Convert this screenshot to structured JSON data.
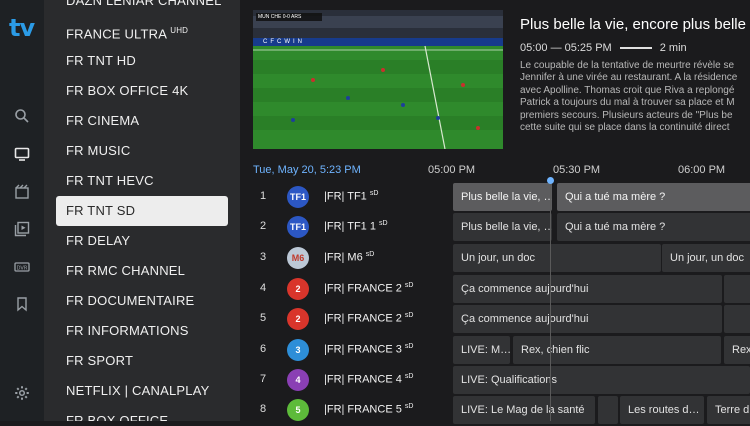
{
  "app": {
    "logo_text": "tv",
    "accent": "#2b9be6"
  },
  "rail": {
    "icons": [
      "search-icon",
      "tv-icon",
      "movie-icon",
      "series-icon",
      "dvr-icon",
      "bookmark-icon",
      "settings-icon"
    ]
  },
  "groups": [
    {
      "label": "DAZN LENIAR CHANNEL",
      "selected": false
    },
    {
      "label": "FRANCE ULTRA ",
      "sup": "UHD",
      "selected": false
    },
    {
      "label": "FR TNT HD",
      "selected": false
    },
    {
      "label": "FR BOX OFFICE 4K",
      "selected": false
    },
    {
      "label": "FR CINEMA",
      "selected": false
    },
    {
      "label": "FR  MUSIC",
      "selected": false
    },
    {
      "label": "FR TNT HEVC",
      "selected": false
    },
    {
      "label": "FR TNT SD",
      "selected": true
    },
    {
      "label": "FR DELAY",
      "selected": false
    },
    {
      "label": "FR RMC CHANNEL",
      "selected": false
    },
    {
      "label": "FR DOCUMENTAIRE",
      "selected": false
    },
    {
      "label": "FR INFORMATIONS",
      "selected": false
    },
    {
      "label": "FR SPORT",
      "selected": false
    },
    {
      "label": "NETFLIX | CANALPLAY",
      "selected": false
    },
    {
      "label": "FR BOX OFFICE",
      "selected": false
    }
  ],
  "preview": {
    "scorebug": "MUN  CHE  0-0  ARS",
    "ad_board": "CFCWIN"
  },
  "info": {
    "title": "Plus belle la vie, encore plus belle",
    "time_range": "05:00 — 05:25 PM",
    "duration": "2 min",
    "description": [
      "Le coupable de la tentative de meurtre révèle se",
      "Jennifer à une virée au restaurant. A la résidence",
      "avec Apolline. Thomas croit que Riva a replongé",
      "Patrick a toujours du mal à trouver sa place et M",
      "premiers secours. Plusieurs acteurs de \"Plus be",
      "cette suite qui se place dans la continuité direct"
    ]
  },
  "epg": {
    "date_label": "Tue, May 20, 5:23 PM",
    "ticks": [
      "05:00 PM",
      "05:30 PM",
      "06:00 PM"
    ],
    "rows": [
      {
        "num": "1",
        "name": "|FR| TF1 ",
        "sup": "sD",
        "logo": {
          "text": "TF1",
          "color": "#2c57c4"
        },
        "cells": [
          {
            "title": "Plus belle la vie, …",
            "highlight": true
          },
          {
            "title": "Qui a tué ma mère ?",
            "highlight": true
          }
        ]
      },
      {
        "num": "2",
        "name": "|FR| TF1  1 ",
        "sup": "sD",
        "logo": {
          "text": "TF1",
          "color": "#2c57c4"
        },
        "cells": [
          {
            "title": "Plus belle la vie, …"
          },
          {
            "title": "Qui a tué ma mère ?"
          }
        ]
      },
      {
        "num": "3",
        "name": "|FR| M6 ",
        "sup": "sD",
        "logo": {
          "text": "M6",
          "color": "#bcc8d6"
        },
        "cells": [
          {
            "title": "Un jour, un doc"
          },
          {
            "title": "Un jour, un doc"
          }
        ]
      },
      {
        "num": "4",
        "name": "|FR| FRANCE 2 ",
        "sup": "sD",
        "logo": {
          "text": "2",
          "color": "#d9352b"
        },
        "cells": [
          {
            "title": "Ça commence aujourd'hui"
          },
          {
            "title": ""
          }
        ]
      },
      {
        "num": "5",
        "name": "|FR| FRANCE 2 ",
        "sup": "sD",
        "logo": {
          "text": "2",
          "color": "#d9352b"
        },
        "cells": [
          {
            "title": "Ça commence aujourd'hui"
          },
          {
            "title": ""
          }
        ]
      },
      {
        "num": "6",
        "name": "|FR| FRANCE 3 ",
        "sup": "sD",
        "logo": {
          "text": "3",
          "color": "#2d8ed8"
        },
        "cells": [
          {
            "title": "LIVE: M…"
          },
          {
            "title": "Rex, chien flic"
          },
          {
            "title": "Rex,"
          }
        ]
      },
      {
        "num": "7",
        "name": "|FR| FRANCE 4 ",
        "sup": "sD",
        "logo": {
          "text": "4",
          "color": "#8a3fb4"
        },
        "cells": [
          {
            "title": "LIVE: Qualifications"
          }
        ]
      },
      {
        "num": "8",
        "name": "|FR| FRANCE 5 ",
        "sup": "sD",
        "logo": {
          "text": "5",
          "color": "#5dbb3a"
        },
        "cells": [
          {
            "title": "LIVE: Le Mag de la santé"
          },
          {
            "title": ""
          },
          {
            "title": "Les routes d…"
          },
          {
            "title": "Terre d"
          }
        ]
      }
    ]
  }
}
